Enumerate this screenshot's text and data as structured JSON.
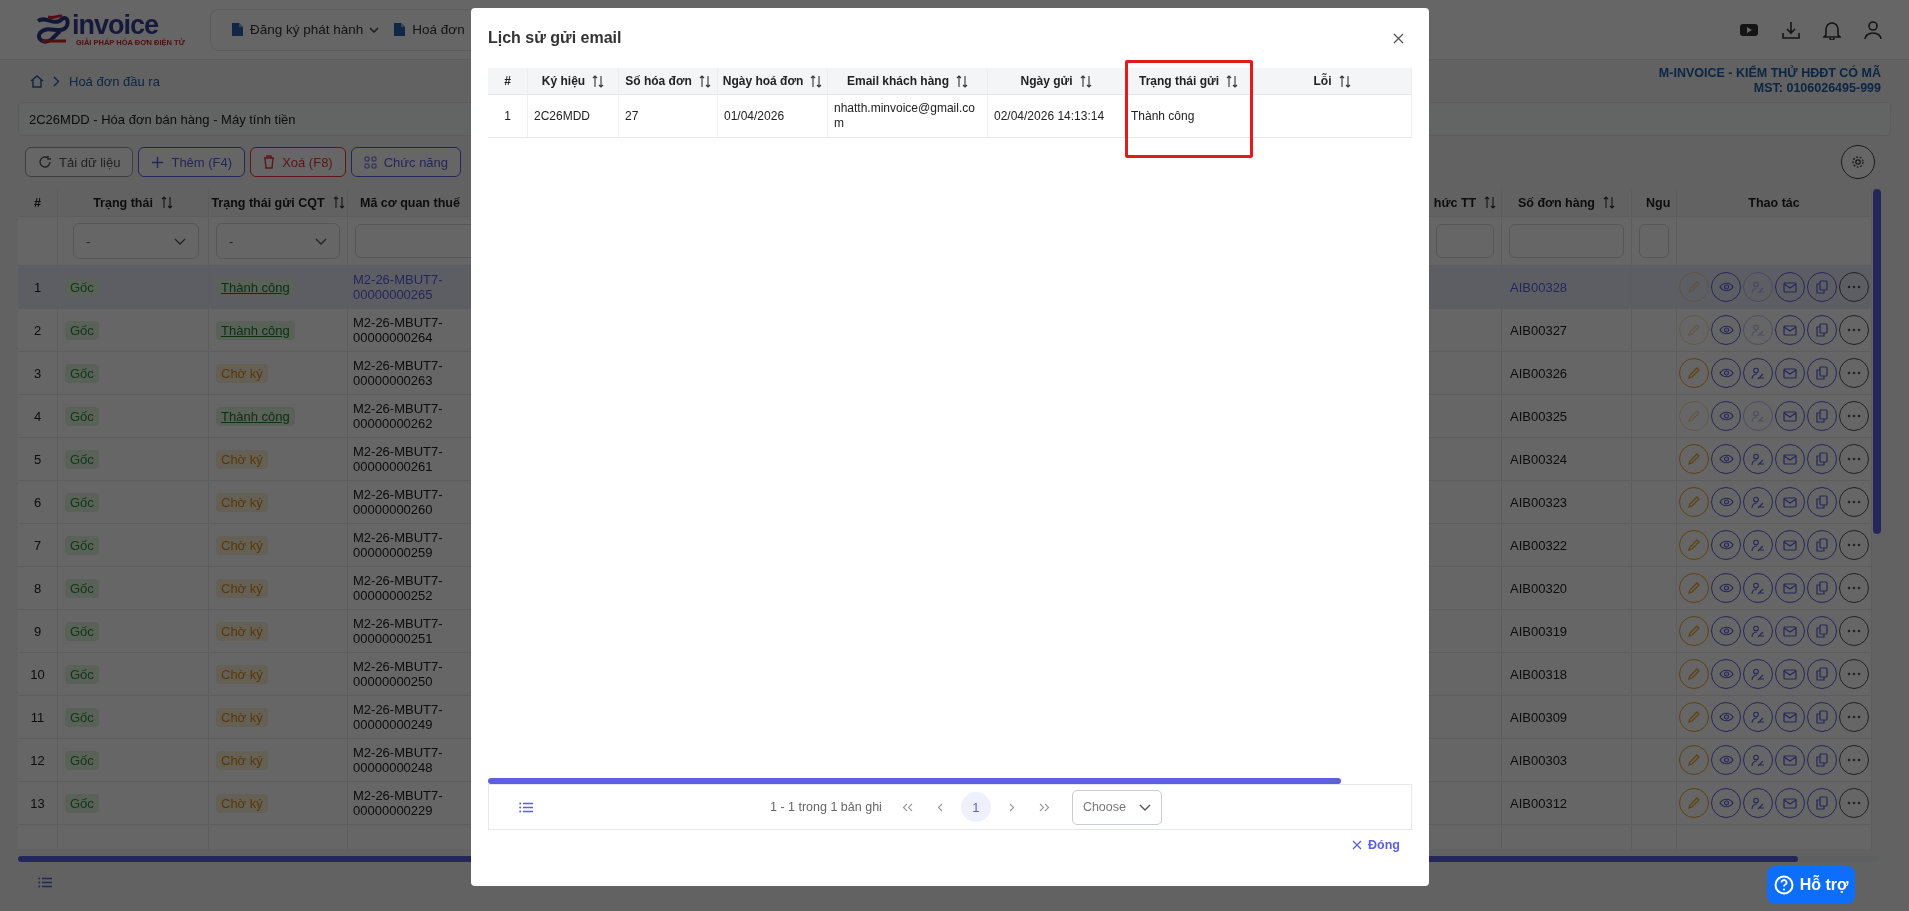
{
  "header": {
    "logo": {
      "name": "invoice",
      "tagline": "GIẢI PHÁP HÓA ĐƠN ĐIỆN TỬ"
    },
    "nav": [
      {
        "label": "Đăng ký phát hành",
        "dropdown": true
      },
      {
        "label": "Hoá đơn",
        "dropdown": false
      }
    ]
  },
  "breadcrumb": [
    "Hoá đơn đầu ra"
  ],
  "company": {
    "name": "M-INVOICE - KIỂM THỬ HĐĐT CÓ MÃ",
    "tax_id": "MST: 0106026495-999"
  },
  "series_select": {
    "value": "2C26MDD - Hóa đơn bán hàng - Máy tính tiền"
  },
  "toolbar": [
    {
      "label": "Tải dữ liệu",
      "kind": "reload"
    },
    {
      "label": "Thêm (F4)",
      "kind": "add"
    },
    {
      "label": "Xoá (F8)",
      "kind": "delete"
    },
    {
      "label": "Chức năng",
      "kind": "functions"
    }
  ],
  "table": {
    "columns": [
      {
        "label": "#",
        "kind": "index",
        "sortable": false
      },
      {
        "label": "Trạng thái",
        "kind": "status",
        "sortable": true,
        "filter": {
          "kind": "select",
          "value": "-"
        }
      },
      {
        "label": "Trạng thái gửi CQT",
        "kind": "cqt",
        "sortable": true,
        "filter": {
          "kind": "select",
          "value": "-"
        }
      },
      {
        "label": "Mã cơ quan thuế",
        "kind": "code",
        "sortable": false,
        "filter": {
          "kind": "input"
        }
      },
      {
        "label": "hức TT",
        "kind": "blank",
        "sortable": true,
        "filter": {
          "kind": "input"
        }
      },
      {
        "label": "Số đơn hàng",
        "kind": "order",
        "sortable": true,
        "filter": {
          "kind": "input"
        }
      },
      {
        "label": "Ngu",
        "kind": "blank",
        "sortable": false,
        "filter": {
          "kind": "input"
        }
      },
      {
        "label": "Thao tác",
        "kind": "actions",
        "sortable": false
      }
    ],
    "rows": [
      {
        "no": "1",
        "status": "Gốc",
        "cqt": {
          "text": "Thành công",
          "kind": "success"
        },
        "code": "M2-26-MBUT7-00000000265",
        "order": "AIB00328",
        "selected": true,
        "actions_disabled": true
      },
      {
        "no": "2",
        "status": "Gốc",
        "cqt": {
          "text": "Thành công",
          "kind": "success"
        },
        "code": "M2-26-MBUT7-00000000264",
        "order": "AIB00327",
        "selected": false,
        "actions_disabled": true
      },
      {
        "no": "3",
        "status": "Gốc",
        "cqt": {
          "text": "Chờ ký",
          "kind": "pending"
        },
        "code": "M2-26-MBUT7-00000000263",
        "order": "AIB00326",
        "selected": false,
        "actions_disabled": false
      },
      {
        "no": "4",
        "status": "Gốc",
        "cqt": {
          "text": "Thành công",
          "kind": "success"
        },
        "code": "M2-26-MBUT7-00000000262",
        "order": "AIB00325",
        "selected": false,
        "actions_disabled": true
      },
      {
        "no": "5",
        "status": "Gốc",
        "cqt": {
          "text": "Chờ ký",
          "kind": "pending"
        },
        "code": "M2-26-MBUT7-00000000261",
        "order": "AIB00324",
        "selected": false,
        "actions_disabled": false
      },
      {
        "no": "6",
        "status": "Gốc",
        "cqt": {
          "text": "Chờ ký",
          "kind": "pending"
        },
        "code": "M2-26-MBUT7-00000000260",
        "order": "AIB00323",
        "selected": false,
        "actions_disabled": false
      },
      {
        "no": "7",
        "status": "Gốc",
        "cqt": {
          "text": "Chờ ký",
          "kind": "pending"
        },
        "code": "M2-26-MBUT7-00000000259",
        "order": "AIB00322",
        "selected": false,
        "actions_disabled": false
      },
      {
        "no": "8",
        "status": "Gốc",
        "cqt": {
          "text": "Chờ ký",
          "kind": "pending"
        },
        "code": "M2-26-MBUT7-00000000252",
        "order": "AIB00320",
        "selected": false,
        "actions_disabled": false
      },
      {
        "no": "9",
        "status": "Gốc",
        "cqt": {
          "text": "Chờ ký",
          "kind": "pending"
        },
        "code": "M2-26-MBUT7-00000000251",
        "order": "AIB00319",
        "selected": false,
        "actions_disabled": false
      },
      {
        "no": "10",
        "status": "Gốc",
        "cqt": {
          "text": "Chờ ký",
          "kind": "pending"
        },
        "code": "M2-26-MBUT7-00000000250",
        "order": "AIB00318",
        "selected": false,
        "actions_disabled": false
      },
      {
        "no": "11",
        "status": "Gốc",
        "cqt": {
          "text": "Chờ ký",
          "kind": "pending"
        },
        "code": "M2-26-MBUT7-00000000249",
        "order": "AIB00309",
        "selected": false,
        "actions_disabled": false
      },
      {
        "no": "12",
        "status": "Gốc",
        "cqt": {
          "text": "Chờ ký",
          "kind": "pending"
        },
        "code": "M2-26-MBUT7-00000000248",
        "order": "AIB00303",
        "selected": false,
        "actions_disabled": false
      },
      {
        "no": "13",
        "status": "Gốc",
        "cqt": {
          "text": "Chờ ký",
          "kind": "pending"
        },
        "code": "M2-26-MBUT7-00000000229",
        "order": "AIB00312",
        "selected": false,
        "actions_disabled": false
      }
    ]
  },
  "dialog": {
    "title": "Lịch sử gửi email",
    "columns": [
      {
        "label": "#",
        "sortable": false,
        "highlighted": false
      },
      {
        "label": "Ký hiệu",
        "sortable": true,
        "highlighted": false
      },
      {
        "label": "Số hóa đơn",
        "sortable": true,
        "highlighted": false
      },
      {
        "label": "Ngày hoá đơn",
        "sortable": true,
        "highlighted": false
      },
      {
        "label": "Email khách hàng",
        "sortable": true,
        "highlighted": false
      },
      {
        "label": "Ngày gửi",
        "sortable": true,
        "highlighted": false
      },
      {
        "label": "Trạng thái gửi",
        "sortable": true,
        "highlighted": true
      },
      {
        "label": "Lỗi",
        "sortable": true,
        "highlighted": false
      }
    ],
    "rows": [
      {
        "cells": [
          "1",
          "2C26MDD",
          "27",
          "01/04/2026",
          "nhatth.minvoice@gmail.com",
          "02/04/2026 14:13:14",
          "Thành công"
        ]
      }
    ],
    "pagination": {
      "summary": "1 - 1 trong 1 bản ghi",
      "pages": [
        {
          "label": "1",
          "selected": true
        }
      ],
      "page_size_placeholder": "Choose"
    },
    "close_label": "Đóng"
  },
  "support_button": {
    "label": "Hỗ trợ"
  }
}
